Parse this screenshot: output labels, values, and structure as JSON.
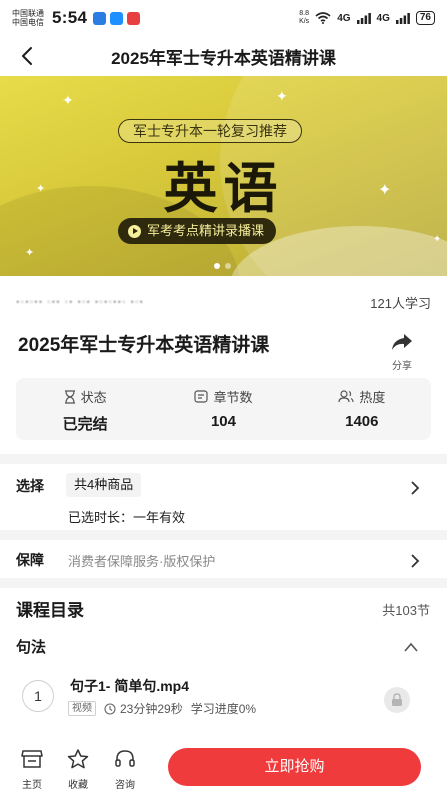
{
  "status": {
    "carrier1": "中国联通",
    "carrier2": "中国电信",
    "time": "5:54",
    "net_speed": "8.8",
    "net_unit": "K/s",
    "signal1": "4G",
    "signal2": "4G",
    "battery": "76"
  },
  "nav": {
    "title": "2025年军士专升本英语精讲课"
  },
  "banner": {
    "pill": "军士专升本一轮复习推荐",
    "big": "英语",
    "sub": "军考考点精讲录播课",
    "colors": {
      "bg": "#dccd3e",
      "dark": "#2f2a0d"
    }
  },
  "meta": {
    "learners": "121人学习"
  },
  "course": {
    "title": "2025年军士专升本英语精讲课",
    "share_label": "分享"
  },
  "stats": [
    {
      "icon": "hourglass-icon",
      "label": "状态",
      "value": "已完结"
    },
    {
      "icon": "chat-list-icon",
      "label": "章节数",
      "value": "104"
    },
    {
      "icon": "users-icon",
      "label": "热度",
      "value": "1406"
    }
  ],
  "select": {
    "label": "选择",
    "chip": "共4种商品",
    "selected": "已选时长：一年有效"
  },
  "guarantee": {
    "label": "保障",
    "text": "消费者保障服务·版权保护"
  },
  "catalog": {
    "title": "课程目录",
    "count": "共103节",
    "section": "句法",
    "lessons": [
      {
        "num": "1",
        "name": "句子1- 简单句.mp4",
        "tag": "视频",
        "duration": "23分钟29秒",
        "progress": "学习进度0%"
      }
    ]
  },
  "bottom": {
    "tabs": [
      {
        "label": "主页",
        "icon": "store-icon"
      },
      {
        "label": "收藏",
        "icon": "star-icon"
      },
      {
        "label": "咨询",
        "icon": "headset-icon"
      }
    ],
    "buy": "立即抢购",
    "accent": "#f03b3d"
  }
}
